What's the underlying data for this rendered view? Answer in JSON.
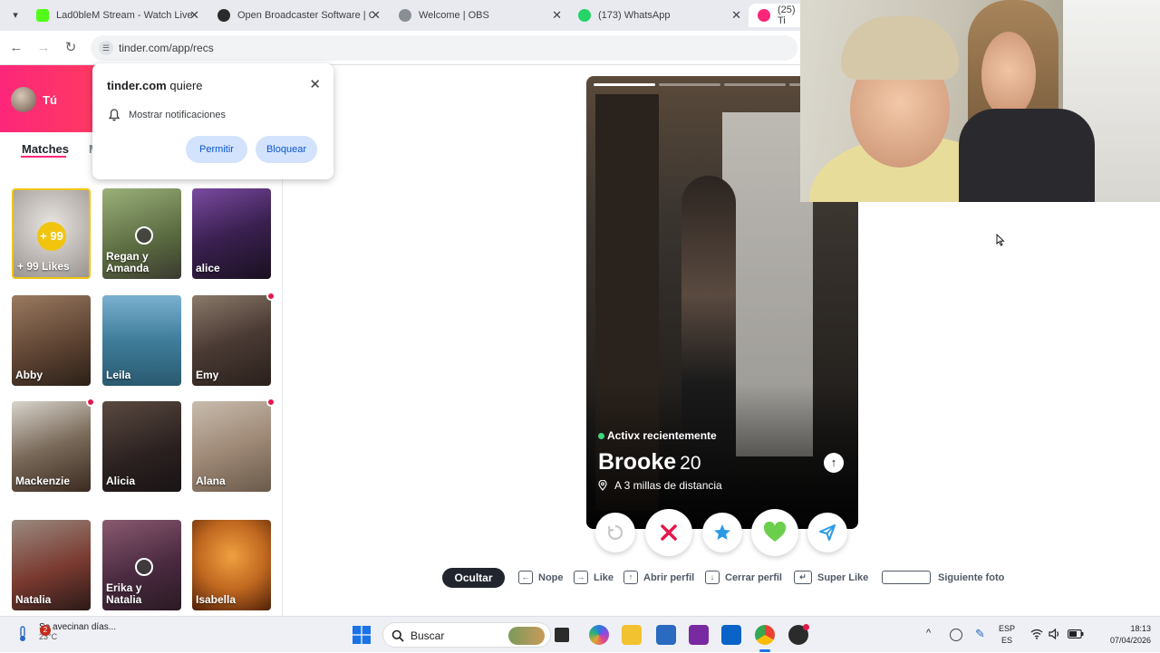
{
  "browser": {
    "tabs": [
      {
        "title": "Lad0bleM Stream - Watch Live o",
        "favicon_color": "#53fc18"
      },
      {
        "title": "Open Broadcaster Software | OI",
        "favicon_color": "#2b2b2b"
      },
      {
        "title": "Welcome | OBS",
        "favicon_color": "#5f6368"
      },
      {
        "title": "(173) WhatsApp",
        "favicon_color": "#25d366"
      },
      {
        "title": "(25) Ti",
        "favicon_color": "#fd267a"
      }
    ],
    "close_glyph": "✕",
    "url": "tinder.com/app/recs"
  },
  "left_panel": {
    "profile_name": "Tú",
    "tabs": {
      "matches": "Matches",
      "messages": "M"
    },
    "likes": {
      "badge": "+ 99",
      "label": "+ 99 Likes"
    },
    "matches": [
      {
        "name": "Regan y Amanda",
        "group": true,
        "new": false,
        "color": "#8a9a6a"
      },
      {
        "name": "alice",
        "group": false,
        "new": false,
        "color": "#5a3a7a"
      },
      {
        "name": "Abby",
        "group": false,
        "new": false,
        "color": "#6a5040"
      },
      {
        "name": "Leila",
        "group": false,
        "new": false,
        "color": "#3f7d9a"
      },
      {
        "name": "Emy",
        "group": false,
        "new": true,
        "color": "#4a3a34"
      },
      {
        "name": "Mackenzie",
        "group": false,
        "new": true,
        "color": "#5a4a3a"
      },
      {
        "name": "Alicia",
        "group": false,
        "new": false,
        "color": "#3a3030"
      },
      {
        "name": "Alana",
        "group": false,
        "new": true,
        "color": "#b0a090"
      },
      {
        "name": "Natalia",
        "group": false,
        "new": false,
        "color": "#7a4a3a"
      },
      {
        "name": "Erika y Natalia",
        "group": true,
        "new": false,
        "color": "#5a3a50"
      },
      {
        "name": "Isabella",
        "group": false,
        "new": false,
        "color": "#c06820"
      }
    ]
  },
  "notification": {
    "site": "tinder.com",
    "verb": "quiere",
    "request": "Mostrar notificaciones",
    "allow": "Permitir",
    "block": "Bloquear"
  },
  "profile_card": {
    "status": "Activx recientemente",
    "name": "Brooke",
    "age": "20",
    "distance": "A 3 millas de distancia",
    "photo_count": 4,
    "current_photo": 1
  },
  "actions": [
    "rewind-icon",
    "nope-x-icon",
    "super-like-star-icon",
    "like-heart-icon",
    "boost-send-icon"
  ],
  "hints": {
    "hide": "Ocultar",
    "nope": "Nope",
    "like": "Like",
    "open_profile": "Abrir perfil",
    "close_profile": "Cerrar perfil",
    "super_like": "Super Like",
    "next_photo": "Siguiente foto"
  },
  "taskbar": {
    "weather_text": "Se avecinan días...",
    "temperature": "23°C",
    "weather_badge": "2",
    "search_label": "Buscar",
    "lang_top": "ESP",
    "lang_bottom": "ES",
    "time": "18:13",
    "date": "07/04/2026"
  },
  "colors": {
    "tinder_gradient_start": "#fd267a",
    "tinder_gradient_end": "#ff6036",
    "nope": "#e4184b",
    "super_like": "#2a9ae6",
    "like": "#6ad04b",
    "boost": "#2a9ae6"
  }
}
